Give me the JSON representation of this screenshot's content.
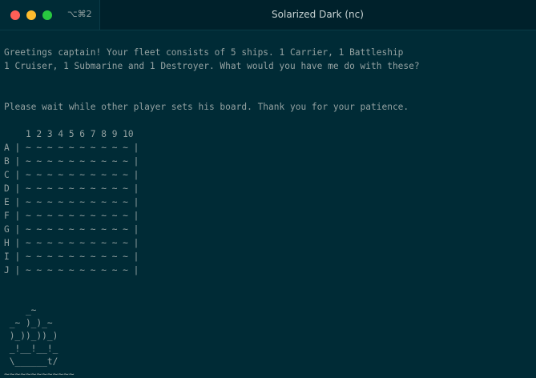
{
  "window": {
    "title": "Solarized Dark (nc)",
    "tab_shortcut": "⌥⌘2",
    "traffic_colors": {
      "close": "#fe5f57",
      "minimize": "#febc2e",
      "zoom": "#28c840"
    }
  },
  "terminal": {
    "greeting_lines": [
      "Greetings captain! Your fleet consists of 5 ships. 1 Carrier, 1 Battleship",
      "1 Cruiser, 1 Submarine and 1 Destroyer. What would you have me do with these?"
    ],
    "wait_message": "Please wait while other player sets his board. Thank you for your patience.",
    "board": {
      "header": "    1 2 3 4 5 6 7 8 9 10",
      "rows": [
        "A | ~ ~ ~ ~ ~ ~ ~ ~ ~ ~ |",
        "B | ~ ~ ~ ~ ~ ~ ~ ~ ~ ~ |",
        "C | ~ ~ ~ ~ ~ ~ ~ ~ ~ ~ |",
        "D | ~ ~ ~ ~ ~ ~ ~ ~ ~ ~ |",
        "E | ~ ~ ~ ~ ~ ~ ~ ~ ~ ~ |",
        "F | ~ ~ ~ ~ ~ ~ ~ ~ ~ ~ |",
        "G | ~ ~ ~ ~ ~ ~ ~ ~ ~ ~ |",
        "H | ~ ~ ~ ~ ~ ~ ~ ~ ~ ~ |",
        "I | ~ ~ ~ ~ ~ ~ ~ ~ ~ ~ |",
        "J | ~ ~ ~ ~ ~ ~ ~ ~ ~ ~ |"
      ]
    },
    "ship_art": [
      "    _~",
      " _~ )_)_~",
      " )_))_))_)",
      " _!__!__!_",
      " \\______t/",
      "~~~~~~~~~~~~~"
    ]
  }
}
